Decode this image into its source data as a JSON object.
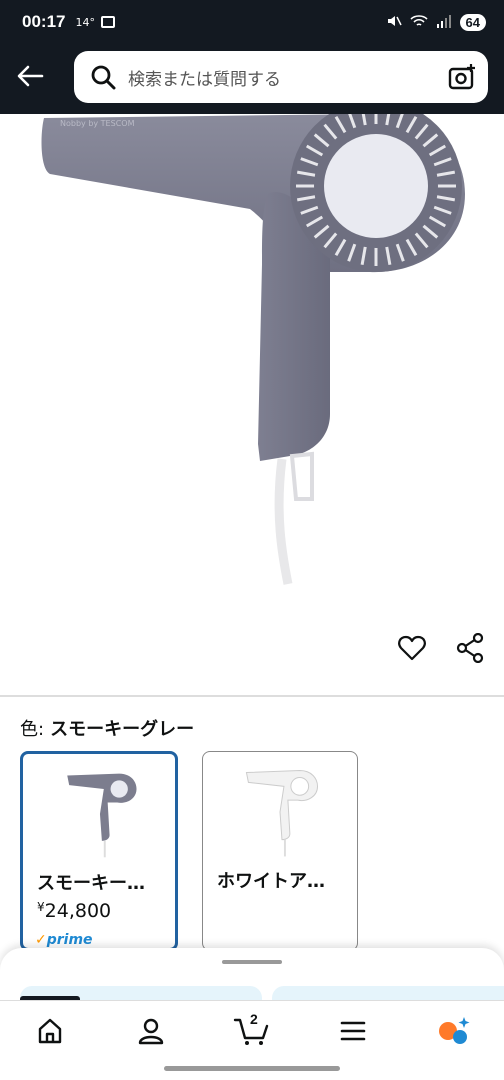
{
  "status_bar": {
    "time": "00:17",
    "temp": "14°",
    "battery": "64"
  },
  "search": {
    "placeholder": "検索または質問する"
  },
  "product_image": {
    "brand_text": "Nobby by TESCOM",
    "accent_color": "#7c7d8e"
  },
  "color_selector": {
    "label": "色:",
    "selected_value": "スモーキーグレー",
    "options": [
      {
        "name": "スモーキー…",
        "price_symbol": "¥",
        "price": "24,800",
        "prime": "prime",
        "selected": true
      },
      {
        "name": "ホワイトア…",
        "selected": false
      }
    ]
  },
  "bottom_nav": {
    "items": [
      {
        "icon": "home-icon"
      },
      {
        "icon": "account-icon"
      },
      {
        "icon": "cart-icon",
        "count": "2"
      },
      {
        "icon": "menu-icon"
      },
      {
        "icon": "rufus-icon"
      }
    ]
  },
  "colors": {
    "header_bg": "#131921",
    "selected_border": "#2162a1",
    "prime_blue": "#1f8ad3",
    "prime_check": "#ff9900"
  }
}
